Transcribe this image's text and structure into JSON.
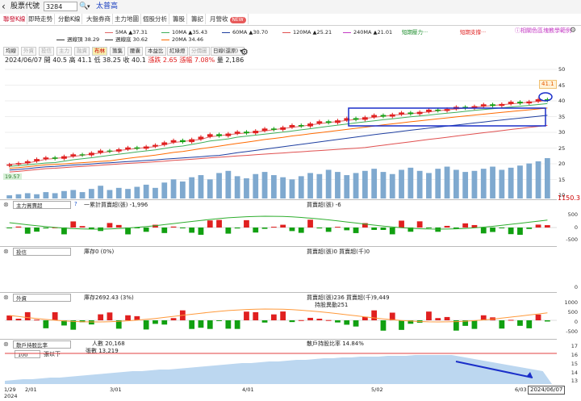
{
  "topbar": {
    "back_glyph": "‹",
    "code_label": "股票代號",
    "code_value": "3284",
    "search_glyph": "🔍",
    "dropdown_glyph": "▾",
    "stock_name": "太普高"
  },
  "nav": {
    "tabs": [
      {
        "label": "聯發K線",
        "active": true
      },
      {
        "label": "即時走勢",
        "active": false
      },
      {
        "label": "分動K線",
        "active": false
      },
      {
        "label": "大盤券商",
        "active": false
      },
      {
        "label": "主力地圖",
        "active": false
      },
      {
        "label": "個股分析",
        "active": false
      },
      {
        "label": "籌股",
        "active": false
      },
      {
        "label": "籌記",
        "active": false
      },
      {
        "label": "月營收",
        "active": false
      }
    ],
    "badge": "NEW"
  },
  "legend": {
    "ma5": "5MA ▲37.31",
    "ma10": "10MA ▲35.43",
    "ma60": "60MA ▲30.70",
    "ma120": "120MA ▲25.21",
    "ma240": "240MA ▲21.01",
    "short_pressure": "短期壓力···",
    "short_support": "短期支撐···",
    "weekly_top": "週線頂 38.29",
    "weekly_bottom": "週線底 30.62",
    "ma20": "20MA 34.46",
    "help_link": "ⓘ相關色區塊教學範例",
    "gear": "⚙"
  },
  "colors": {
    "ma5": "#e06666",
    "ma10": "#3fae5a",
    "ma20": "#ff6a00",
    "ma60": "#1f3fa0",
    "ma120": "#e05050",
    "ma240": "#c43bc4",
    "up": "#e02020",
    "down": "#11a011",
    "volume": "#7fa9cf",
    "accent": "#1a3fbf"
  },
  "info": {
    "date": "2024/06/07",
    "open": "開 40.5",
    "high": "高 41.1",
    "low": "低 38.25",
    "close": "收 40.1",
    "change": "漲跌 2.65",
    "pct": "漲幅 7.08%",
    "volume": "量 2,186",
    "setting_glyph": "⚙"
  },
  "ind_tabs": [
    {
      "label": "均線",
      "state": "normal"
    },
    {
      "label": "外資",
      "state": "dis"
    },
    {
      "label": "投信",
      "state": "dis"
    },
    {
      "label": "主力",
      "state": "dis"
    },
    {
      "label": "融資",
      "state": "dis"
    },
    {
      "label": "布林",
      "state": "on"
    },
    {
      "label": "籌集",
      "state": "normal"
    },
    {
      "label": "腰囊",
      "state": "normal"
    },
    {
      "label": "本益比",
      "state": "normal"
    },
    {
      "label": "紅綠燈",
      "state": "normal"
    },
    {
      "label": "分價圖",
      "state": "dis"
    },
    {
      "label": "日線(還原) ▾",
      "state": "normal"
    }
  ],
  "main_axis": [
    "50",
    "45",
    "40",
    "35",
    "30",
    "25",
    "20",
    "15",
    "10"
  ],
  "price_badge": "41.1",
  "left_badge": "19.57",
  "value_box": "1150.3",
  "panel1": {
    "select": "主力買賣超",
    "q": "?",
    "text1": "一累計買賣超(張) -1,996",
    "text2": "買賣超(張) -6",
    "axis": [
      "500",
      "0",
      "-500"
    ]
  },
  "panel2": {
    "select": "投信",
    "text1": "庫存0 (0%)",
    "text2": "買賣超(張)0 買賣超(千)0",
    "axis": [
      "0"
    ]
  },
  "panel3": {
    "select": "外資",
    "text1": "庫存2692.43 (3%)",
    "text2": "買賣超(張)236 買賣超(千)9,449",
    "text3": "持股異動251",
    "axis": [
      "1000",
      "500",
      "0",
      "-500"
    ]
  },
  "panel4": {
    "select": "散戶持股比率",
    "sub_select": "100",
    "sub_label": "張以下",
    "text1": "人數 20,168",
    "text2": "張數 13,219",
    "text3": "散戶持股比率 14.84%",
    "axis": [
      "17",
      "16",
      "15",
      "14",
      "13"
    ]
  },
  "dates": {
    "d1": "1/29",
    "d1y": "2024",
    "d2": "2/01",
    "d3": "3/01",
    "d4": "4/01",
    "d5": "5/02",
    "d6": "6/03",
    "current": "2024/06/07"
  },
  "chart_data": {
    "type": "candlestick",
    "closes": [
      19.8,
      20.2,
      20.8,
      21.5,
      22.0,
      21.6,
      22.4,
      23.0,
      22.7,
      23.5,
      24.2,
      23.9,
      24.6,
      25.2,
      24.8,
      25.5,
      26.0,
      26.8,
      27.5,
      26.9,
      27.8,
      28.6,
      29.4,
      28.8,
      29.6,
      30.2,
      29.7,
      30.5,
      31.2,
      30.8,
      31.6,
      32.3,
      31.9,
      32.8,
      33.5,
      33.0,
      33.8,
      34.5,
      34.0,
      34.8,
      35.5,
      35.0,
      35.7,
      36.3,
      35.8,
      36.5,
      37.2,
      36.8,
      37.4,
      38.1,
      37.6,
      38.3,
      38.9,
      38.4,
      39.0,
      39.7,
      39.2,
      39.8,
      40.5,
      40.1
    ],
    "vols": [
      3,
      4,
      5,
      4,
      6,
      5,
      7,
      8,
      6,
      9,
      12,
      8,
      10,
      9,
      11,
      13,
      10,
      15,
      18,
      16,
      20,
      22,
      18,
      24,
      26,
      21,
      19,
      23,
      25,
      22,
      20,
      18,
      21,
      24,
      23,
      27,
      25,
      22,
      24,
      26,
      28,
      25,
      23,
      27,
      29,
      26,
      24,
      28,
      30,
      27,
      25,
      26,
      28,
      30,
      27,
      29,
      31,
      33,
      35,
      38
    ],
    "ylim": [
      10,
      50
    ]
  }
}
